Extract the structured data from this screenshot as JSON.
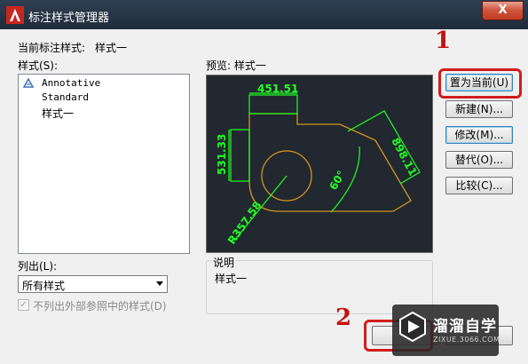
{
  "window": {
    "title": "标注样式管理器",
    "close": "X"
  },
  "current_style": {
    "label": "当前标注样式:",
    "value": "样式一"
  },
  "styles_label": "样式(S):",
  "styles": [
    {
      "name": "Annotative",
      "annotative": true
    },
    {
      "name": "Standard",
      "annotative": false
    },
    {
      "name": "样式一",
      "annotative": false
    }
  ],
  "preview": {
    "label": "预览: 样式一",
    "dims": {
      "top": "451.51",
      "left": "531.33",
      "diag": "898.11",
      "radius": "R357.58",
      "angle": "60°"
    }
  },
  "buttons": [
    {
      "label": "置为当前(U)"
    },
    {
      "label": "新建(N)..."
    },
    {
      "label": "修改(M)..."
    },
    {
      "label": "替代(O)..."
    },
    {
      "label": "比较(C)..."
    }
  ],
  "list_label": "列出(L):",
  "list_select": "所有样式",
  "xref_checkbox": "不列出外部参照中的样式(D)",
  "description": {
    "title": "说明",
    "text": "样式一"
  },
  "annotations": [
    "1",
    "2"
  ],
  "watermark": {
    "name": "溜溜自学",
    "url": "ZIXUE.3066.COM"
  },
  "colors": {
    "dim_green": "#22ff22",
    "geom_orange": "#d4951e",
    "annotation_red": "#d21d1d"
  }
}
